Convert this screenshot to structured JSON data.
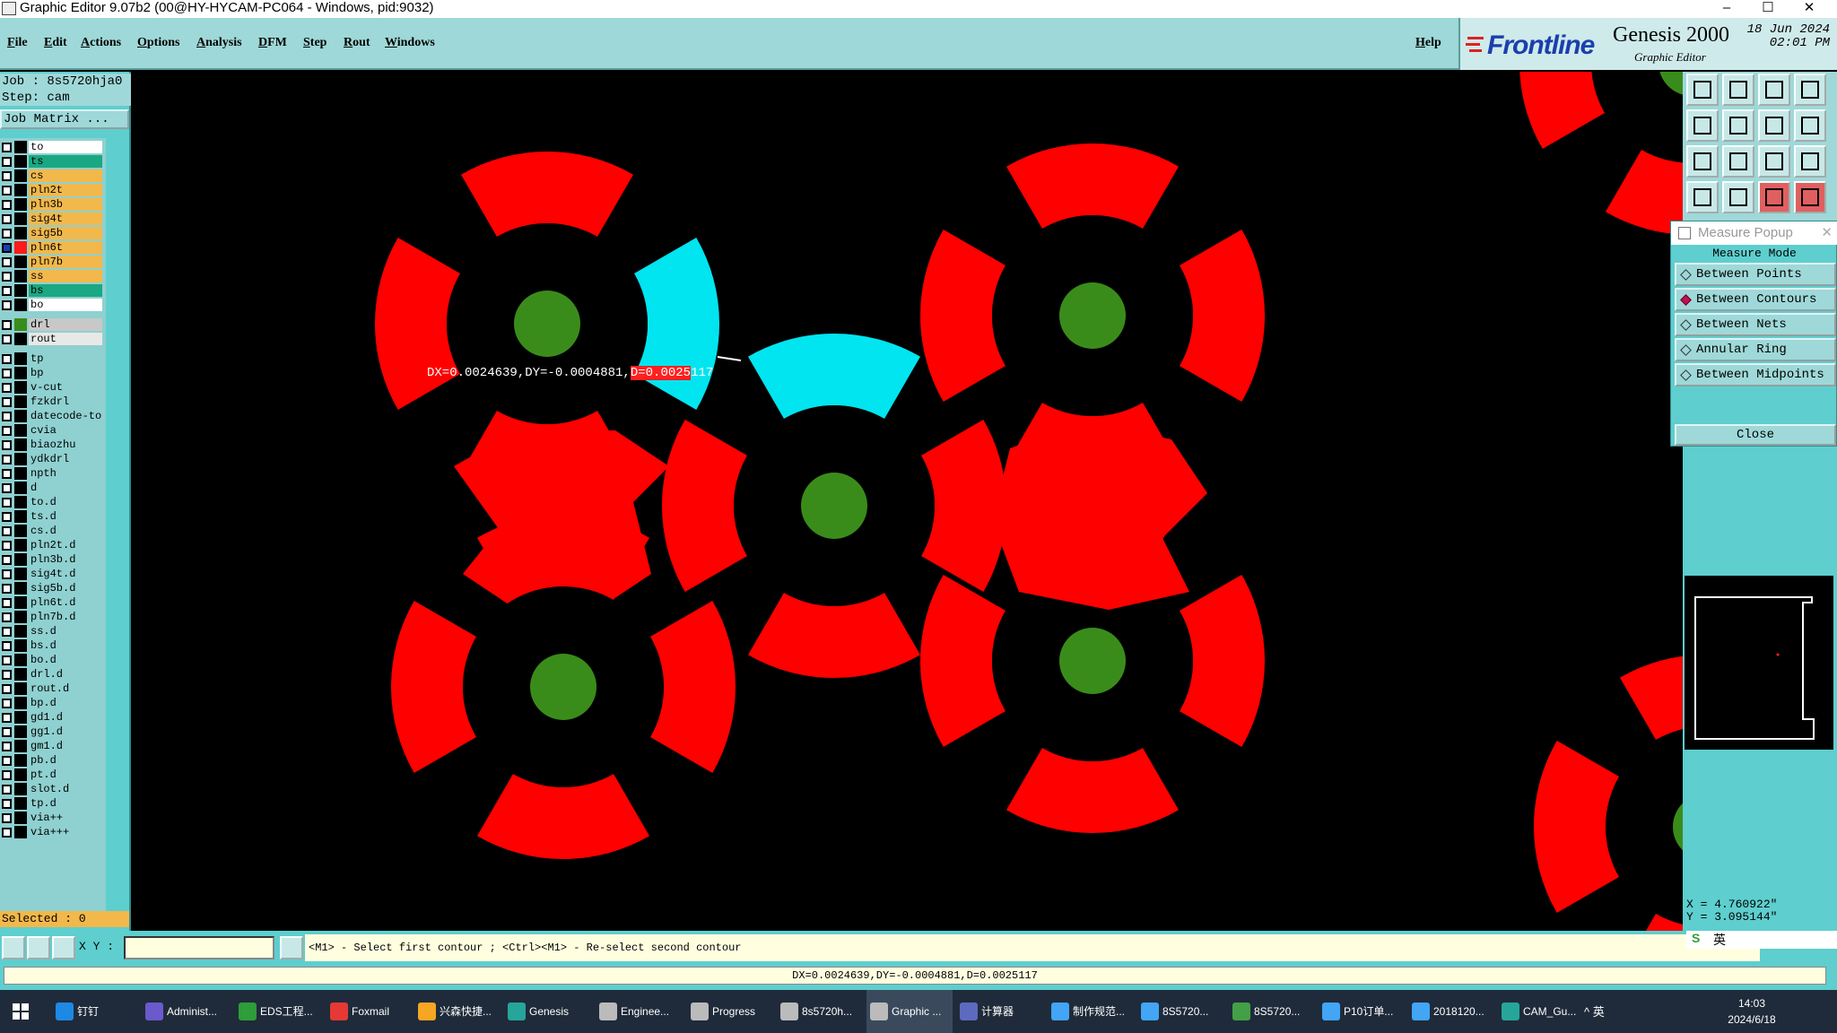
{
  "window": {
    "title": "Graphic Editor 9.07b2 (00@HY-HYCAM-PC064 - Windows, pid:9032)",
    "minimize": "–",
    "maximize": "☐",
    "close": "✕"
  },
  "menu": {
    "items": [
      "File",
      "Edit",
      "Actions",
      "Options",
      "Analysis",
      "DFM",
      "Step",
      "Rout",
      "Windows"
    ],
    "help": "Help"
  },
  "logo": {
    "brand": "Frontline",
    "product": "Genesis 2000",
    "subtitle": "Graphic Editor",
    "date": "18 Jun 2024",
    "time": "02:01 PM"
  },
  "job": {
    "job_label": "Job : 8s5720hja0",
    "step_label": "Step: cam",
    "matrix_button": "Job Matrix ..."
  },
  "layers": [
    {
      "name": "to",
      "color": "#ffffff",
      "swatch": "#000000"
    },
    {
      "name": "ts",
      "color": "#1aa882",
      "swatch": "#000000"
    },
    {
      "name": "cs",
      "color": "#f2b84b",
      "swatch": "#000000"
    },
    {
      "name": "pln2t",
      "color": "#f2b84b",
      "swatch": "#000000"
    },
    {
      "name": "pln3b",
      "color": "#f2b84b",
      "swatch": "#000000"
    },
    {
      "name": "sig4t",
      "color": "#f2b84b",
      "swatch": "#000000"
    },
    {
      "name": "sig5b",
      "color": "#f2b84b",
      "swatch": "#000000"
    },
    {
      "name": "pln6t",
      "color": "#f2b84b",
      "swatch": "#ff1a1a",
      "active": true
    },
    {
      "name": "pln7b",
      "color": "#f2b84b",
      "swatch": "#000000"
    },
    {
      "name": "ss",
      "color": "#f2b84b",
      "swatch": "#000000"
    },
    {
      "name": "bs",
      "color": "#1aa882",
      "swatch": "#000000"
    },
    {
      "name": "bo",
      "color": "#ffffff",
      "swatch": "#000000"
    },
    {
      "name": "drl",
      "color": "#c8c8c8",
      "swatch": "#3a8c1a",
      "gap_before": true
    },
    {
      "name": "rout",
      "color": "#e8e8e8",
      "swatch": "#000000"
    },
    {
      "name": "tp",
      "color": "#8fd0d0",
      "swatch": "#000000",
      "gap_before": true
    },
    {
      "name": "bp",
      "color": "#8fd0d0",
      "swatch": "#000000"
    },
    {
      "name": "v-cut",
      "color": "#8fd0d0",
      "swatch": "#000000"
    },
    {
      "name": "fzkdrl",
      "color": "#8fd0d0",
      "swatch": "#000000"
    },
    {
      "name": "datecode-to",
      "color": "#8fd0d0",
      "swatch": "#000000"
    },
    {
      "name": "cvia",
      "color": "#8fd0d0",
      "swatch": "#000000"
    },
    {
      "name": "biaozhu",
      "color": "#8fd0d0",
      "swatch": "#000000"
    },
    {
      "name": "ydkdrl",
      "color": "#8fd0d0",
      "swatch": "#000000"
    },
    {
      "name": "npth",
      "color": "#8fd0d0",
      "swatch": "#000000"
    },
    {
      "name": "d",
      "color": "#8fd0d0",
      "swatch": "#000000"
    },
    {
      "name": "to.d",
      "color": "#8fd0d0",
      "swatch": "#000000"
    },
    {
      "name": "ts.d",
      "color": "#8fd0d0",
      "swatch": "#000000"
    },
    {
      "name": "cs.d",
      "color": "#8fd0d0",
      "swatch": "#000000"
    },
    {
      "name": "pln2t.d",
      "color": "#8fd0d0",
      "swatch": "#000000"
    },
    {
      "name": "pln3b.d",
      "color": "#8fd0d0",
      "swatch": "#000000"
    },
    {
      "name": "sig4t.d",
      "color": "#8fd0d0",
      "swatch": "#000000"
    },
    {
      "name": "sig5b.d",
      "color": "#8fd0d0",
      "swatch": "#000000"
    },
    {
      "name": "pln6t.d",
      "color": "#8fd0d0",
      "swatch": "#000000"
    },
    {
      "name": "pln7b.d",
      "color": "#8fd0d0",
      "swatch": "#000000"
    },
    {
      "name": "ss.d",
      "color": "#8fd0d0",
      "swatch": "#000000"
    },
    {
      "name": "bs.d",
      "color": "#8fd0d0",
      "swatch": "#000000"
    },
    {
      "name": "bo.d",
      "color": "#8fd0d0",
      "swatch": "#000000"
    },
    {
      "name": "drl.d",
      "color": "#8fd0d0",
      "swatch": "#000000"
    },
    {
      "name": "rout.d",
      "color": "#8fd0d0",
      "swatch": "#000000"
    },
    {
      "name": "bp.d",
      "color": "#8fd0d0",
      "swatch": "#000000"
    },
    {
      "name": "gd1.d",
      "color": "#8fd0d0",
      "swatch": "#000000"
    },
    {
      "name": "gg1.d",
      "color": "#8fd0d0",
      "swatch": "#000000"
    },
    {
      "name": "gm1.d",
      "color": "#8fd0d0",
      "swatch": "#000000"
    },
    {
      "name": "pb.d",
      "color": "#8fd0d0",
      "swatch": "#000000"
    },
    {
      "name": "pt.d",
      "color": "#8fd0d0",
      "swatch": "#000000"
    },
    {
      "name": "slot.d",
      "color": "#8fd0d0",
      "swatch": "#000000"
    },
    {
      "name": "tp.d",
      "color": "#8fd0d0",
      "swatch": "#000000"
    },
    {
      "name": "via++",
      "color": "#8fd0d0",
      "swatch": "#000000"
    },
    {
      "name": "via+++",
      "color": "#8fd0d0",
      "swatch": "#000000"
    }
  ],
  "selected_label": "Selected : 0",
  "canvas": {
    "measure_prefix": "DX=0.0024639,DY=-0.0004881,",
    "measure_highlight": "D=0.0025",
    "measure_suffix": "117",
    "colors": {
      "thermal": "#ff0000",
      "selected": "#00e5f0",
      "drill": "#3a8c1a",
      "background": "#000000"
    }
  },
  "measure_popup": {
    "title": "Measure Popup",
    "close_x": "✕",
    "header": "Measure Mode",
    "options": [
      "Between Points",
      "Between Contours",
      "Between Nets",
      "Annular Ring",
      "Between Midpoints"
    ],
    "selected_index": 1,
    "close_button": "Close"
  },
  "coords": {
    "x": "X = 4.760922\"",
    "y": "Y = 3.095144\""
  },
  "command": {
    "xy_label": "X Y :",
    "xy_value": "",
    "prompt": "<M1> - Select first contour ; <Ctrl><M1> - Re-select second contour",
    "ime_text": "英"
  },
  "status": "DX=0.0024639,DY=-0.0004881,D=0.0025117",
  "taskbar": {
    "items": [
      {
        "label": "钉钉",
        "color": "#1e88e5"
      },
      {
        "label": "Administ...",
        "color": "#6a5acd"
      },
      {
        "label": "EDS工程...",
        "color": "#2e9d3a"
      },
      {
        "label": "Foxmail",
        "color": "#e53935"
      },
      {
        "label": "兴森快捷...",
        "color": "#f5a623"
      },
      {
        "label": "Genesis",
        "color": "#26a69a"
      },
      {
        "label": "Enginee...",
        "color": "#bbbbbb"
      },
      {
        "label": "Progress",
        "color": "#bbbbbb"
      },
      {
        "label": "8s5720h...",
        "color": "#bbbbbb"
      },
      {
        "label": "Graphic ...",
        "color": "#bbbbbb",
        "active": true
      },
      {
        "label": "计算器",
        "color": "#5c6bc0"
      },
      {
        "label": "制作规范...",
        "color": "#42a5f5"
      },
      {
        "label": "8S5720...",
        "color": "#42a5f5"
      },
      {
        "label": "8S5720...",
        "color": "#43a047"
      },
      {
        "label": "P10订单...",
        "color": "#42a5f5"
      },
      {
        "label": "2018120...",
        "color": "#42a5f5"
      },
      {
        "label": "CAM_Gu...",
        "color": "#26a69a"
      }
    ],
    "tray": "^  英",
    "time": "14:03",
    "date": "2024/6/18"
  }
}
